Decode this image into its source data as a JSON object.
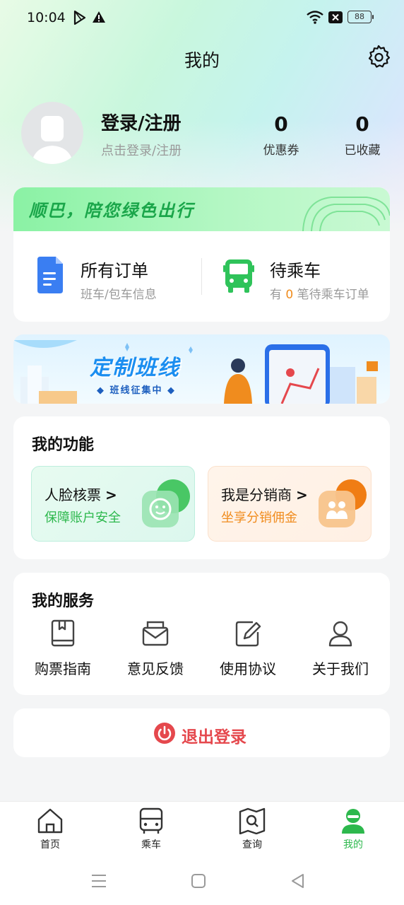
{
  "status_bar": {
    "time": "10:04",
    "battery": "88"
  },
  "header": {
    "title": "我的"
  },
  "profile": {
    "login_title": "登录/注册",
    "login_subtitle": "点击登录/注册",
    "stats": [
      {
        "value": "0",
        "label": "优惠券"
      },
      {
        "value": "0",
        "label": "已收藏"
      }
    ]
  },
  "orders": {
    "banner_text": "顺巴，陪您绿色出行",
    "all_orders": {
      "title": "所有订单",
      "subtitle": "班车/包车信息"
    },
    "waiting": {
      "title": "待乘车",
      "sub_prefix": "有",
      "count": "0",
      "sub_suffix": "笔待乘车订单"
    }
  },
  "promo": {
    "title": "定制班线",
    "subtitle": "◆ 班线征集中 ◆"
  },
  "functions": {
    "title": "我的功能",
    "items": [
      {
        "title": "人脸核票",
        "subtitle": "保障账户安全",
        "color": "#2db84d"
      },
      {
        "title": "我是分销商",
        "subtitle": "坐享分销佣金",
        "color": "#f08c1e"
      }
    ]
  },
  "services": {
    "title": "我的服务",
    "items": [
      {
        "label": "购票指南",
        "icon": "book-icon"
      },
      {
        "label": "意见反馈",
        "icon": "mail-icon"
      },
      {
        "label": "使用协议",
        "icon": "edit-document-icon"
      },
      {
        "label": "关于我们",
        "icon": "person-icon"
      }
    ]
  },
  "logout": {
    "label": "退出登录",
    "color": "#e5484d"
  },
  "tabbar": {
    "active_color": "#2db84d",
    "items": [
      {
        "label": "首页",
        "icon": "home-icon"
      },
      {
        "label": "乘车",
        "icon": "bus-icon"
      },
      {
        "label": "查询",
        "icon": "map-search-icon"
      },
      {
        "label": "我的",
        "icon": "user-icon"
      }
    ]
  }
}
